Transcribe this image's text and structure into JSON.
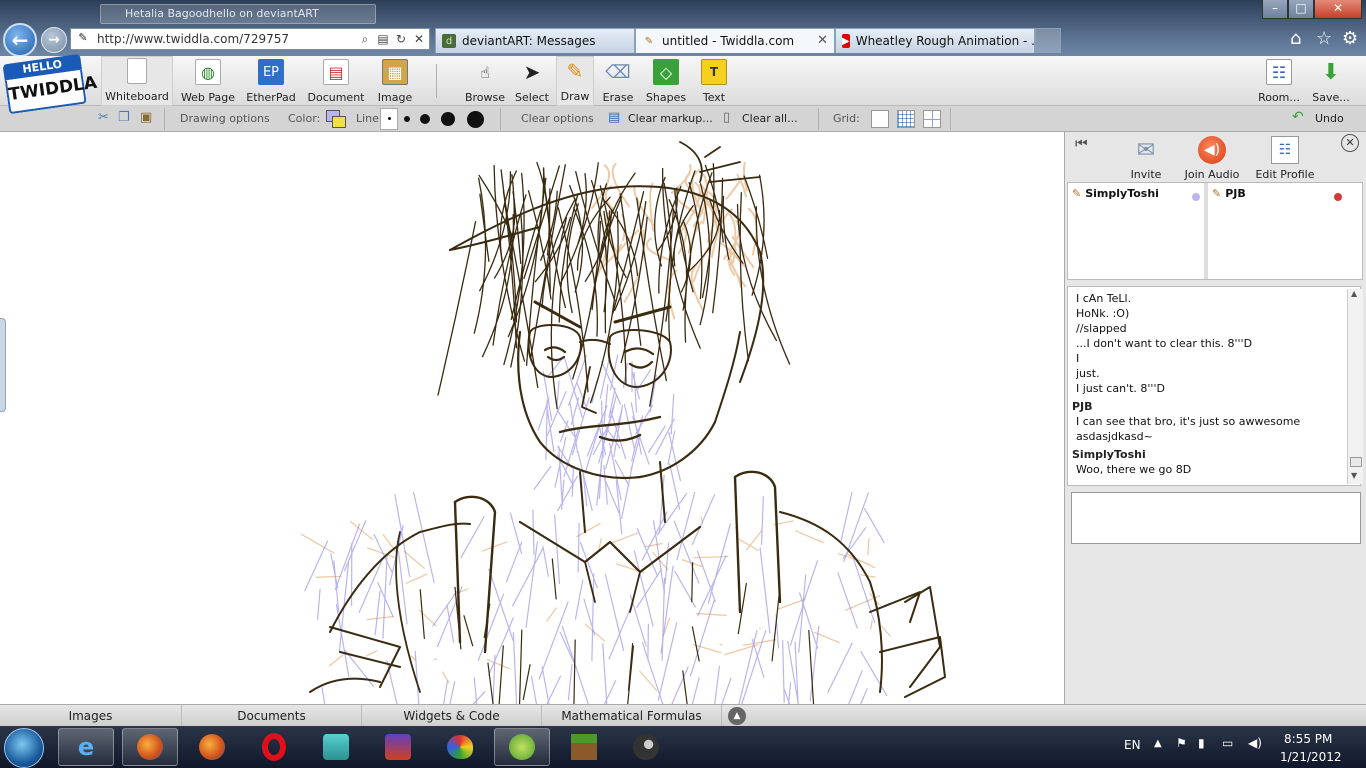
{
  "browser": {
    "background_window_title": "Hetalia Bagoodhello on deviantART",
    "url": "http://www.twiddla.com/729757",
    "tabs": [
      {
        "label": "deviantART: Messages",
        "active": false
      },
      {
        "label": "untitled - Twiddla.com",
        "active": true
      },
      {
        "label": "Wheatley Rough Animation - ...",
        "active": false
      }
    ],
    "window_buttons": {
      "minimize": "–",
      "maximize": "□",
      "close": "✕"
    }
  },
  "logo": {
    "top": "HELLO",
    "bottom": "TWIDDLA"
  },
  "toolbar": {
    "left_tools": [
      "Whiteboard",
      "Web Page",
      "EtherPad",
      "Document",
      "Image"
    ],
    "draw_tools": [
      "Browse",
      "Select",
      "Draw",
      "Erase",
      "Shapes",
      "Text"
    ],
    "selected_tool": "Draw",
    "right_tools": [
      "Room...",
      "Save..."
    ],
    "etherpad_icon_text": "EP",
    "text_icon_text": "T"
  },
  "options": {
    "drawing_options": "Drawing options",
    "color": "Color:",
    "line": "Line:",
    "clear_options": "Clear options",
    "clear_markup": "Clear markup...",
    "clear_all": "Clear all...",
    "grid": "Grid:",
    "undo": "Undo"
  },
  "right_panel": {
    "buttons": [
      "Invite",
      "Join Audio",
      "Edit Profile"
    ],
    "users": [
      {
        "name": "SimplyToshi",
        "status_color": "#b9b5f0"
      },
      {
        "name": "PJB",
        "status_color": "#d23a3a"
      }
    ],
    "chat": [
      {
        "type": "line",
        "text": "I cAn TeLl."
      },
      {
        "type": "line",
        "text": "HoNk. :O)"
      },
      {
        "type": "line",
        "text": "//slapped"
      },
      {
        "type": "line",
        "text": "...I don't want to clear this. 8'''D"
      },
      {
        "type": "line",
        "text": "I"
      },
      {
        "type": "line",
        "text": "just."
      },
      {
        "type": "line",
        "text": "I just can't. 8'''D"
      },
      {
        "type": "author",
        "text": "PJB"
      },
      {
        "type": "line",
        "text": "I can see that bro, it's just so awwesome"
      },
      {
        "type": "line",
        "text": "asdasjdkasd~"
      },
      {
        "type": "author",
        "text": "SimplyToshi"
      },
      {
        "type": "line",
        "text": "Woo, there we go 8D"
      }
    ]
  },
  "bottom_tabs": [
    "Images",
    "Documents",
    "Widgets & Code",
    "Mathematical Formulas"
  ],
  "taskbar": {
    "language": "EN",
    "time": "8:55 PM",
    "date": "1/21/2012",
    "apps": [
      "internet-explorer",
      "firefox",
      "firefox",
      "opera",
      "miku",
      "game",
      "paint",
      "paint-tool",
      "minecraft",
      "steam"
    ]
  },
  "colors": {
    "sketch_ink": "#3a2a10",
    "sketch_purple": "#8c85e0",
    "sketch_orange": "#e0a060",
    "toolbar_bg": "#dcdcdc",
    "brand_blue": "#1b5bb8"
  }
}
